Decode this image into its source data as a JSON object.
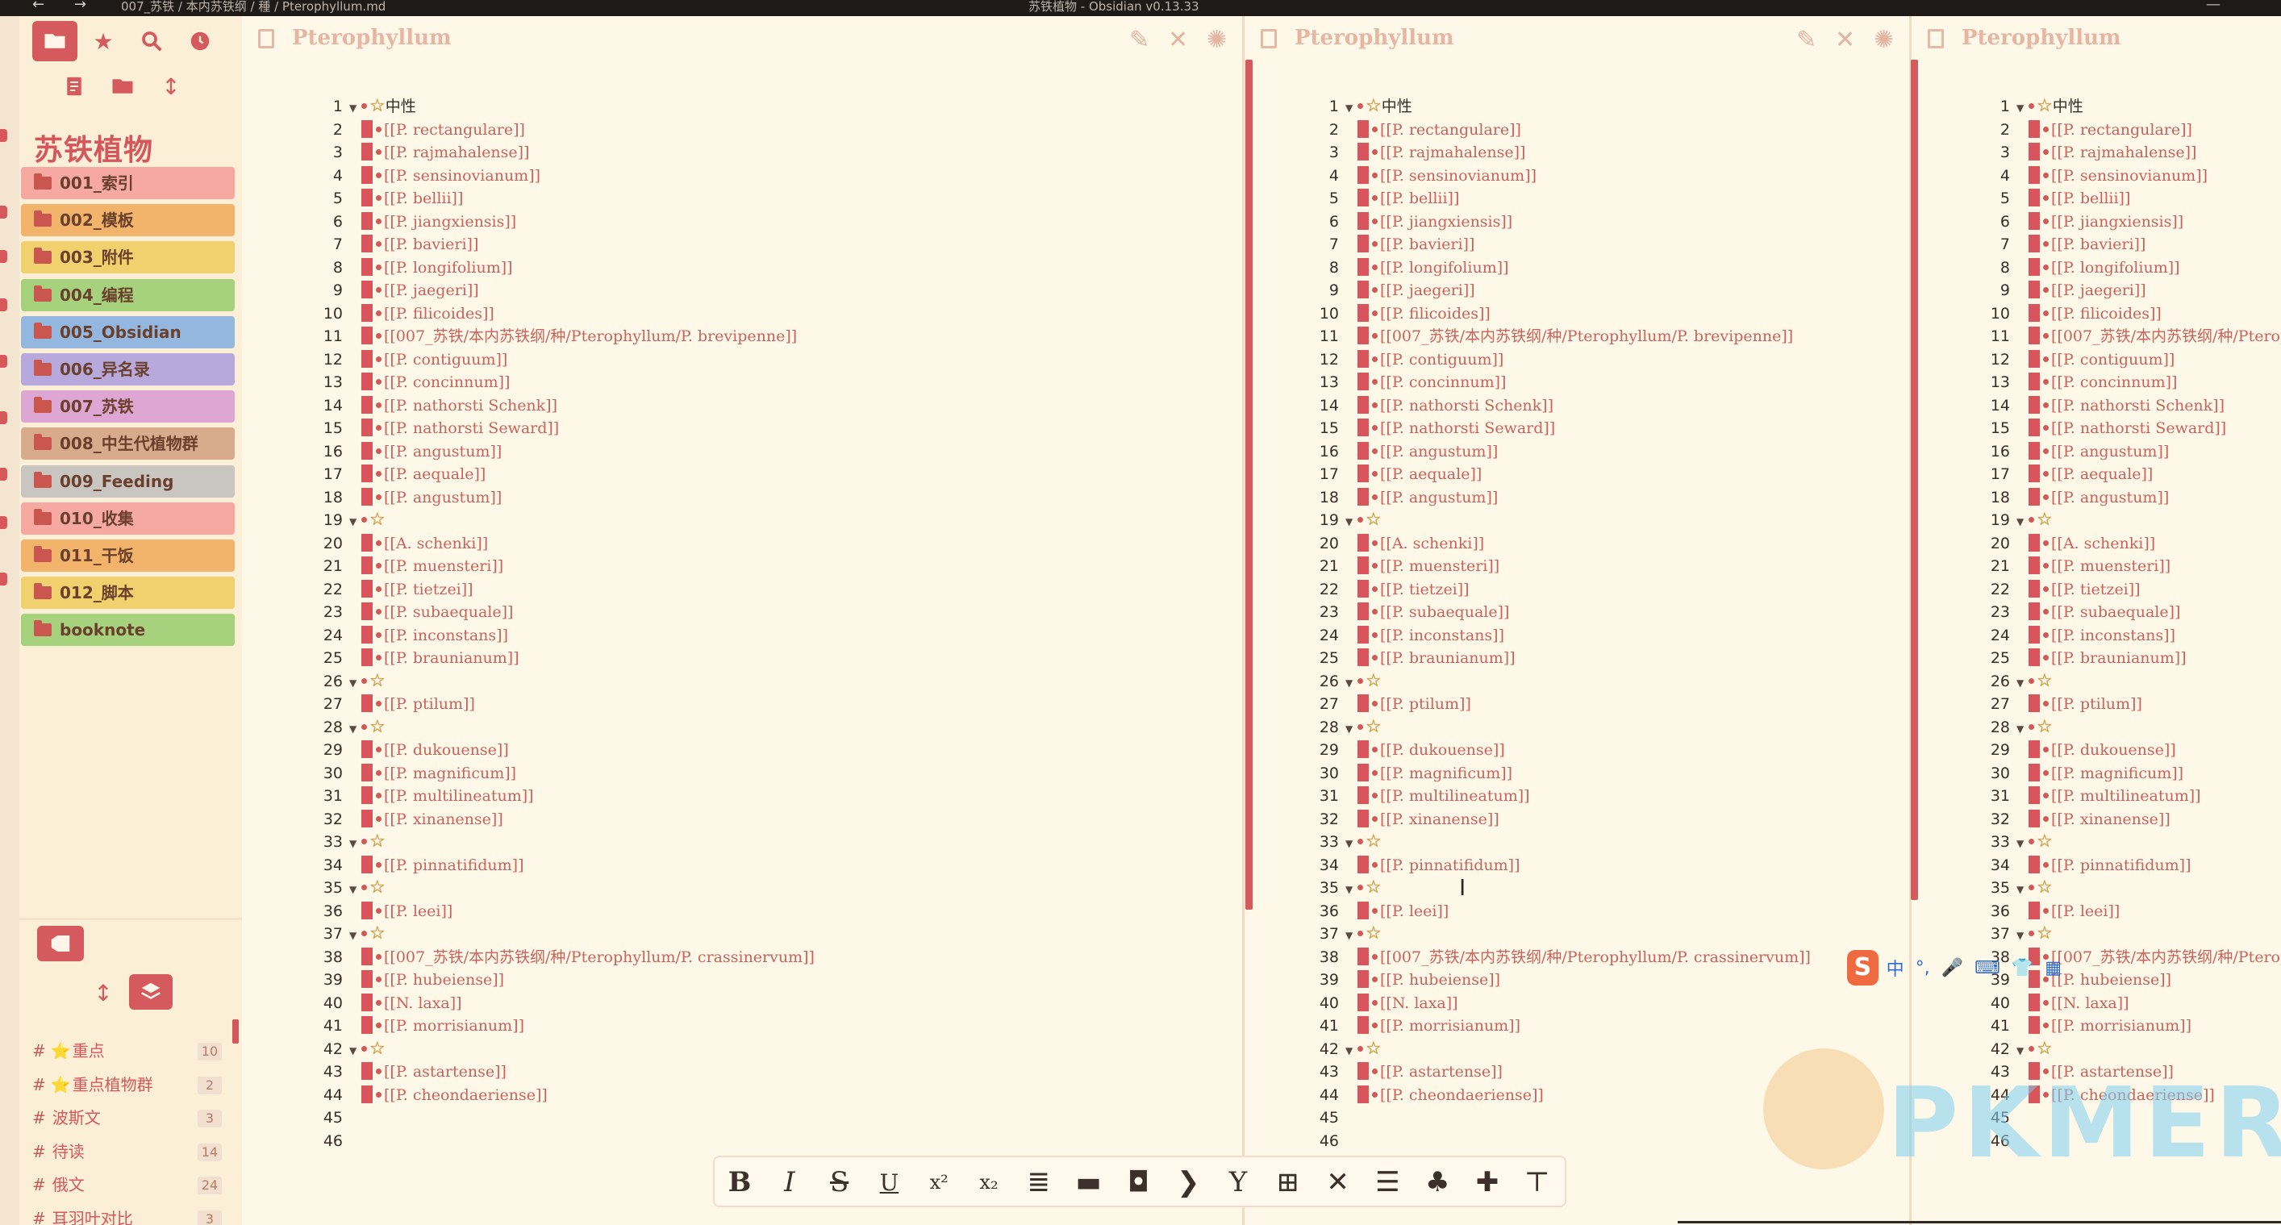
{
  "titlebar": {
    "back": "←",
    "forward": "→",
    "path": "007_苏铁 / 本内苏铁纲 / 種 / Pterophyllum.md",
    "app_title": "苏铁植物 - Obsidian v0.13.33",
    "minimize": "—"
  },
  "sidebar": {
    "vault_name": "苏铁植物",
    "folders": [
      {
        "name": "001_索引",
        "color": "#f6a9a0"
      },
      {
        "name": "002_模板",
        "color": "#f2b46b"
      },
      {
        "name": "003_附件",
        "color": "#f1d06e"
      },
      {
        "name": "004_编程",
        "color": "#a6d17d"
      },
      {
        "name": "005_Obsidian",
        "color": "#93b7df"
      },
      {
        "name": "006_异名录",
        "color": "#b8a9dc"
      },
      {
        "name": "007_苏铁",
        "color": "#dda6d3"
      },
      {
        "name": "008_中生代植物群",
        "color": "#d8ab8d"
      },
      {
        "name": "009_Feeding",
        "color": "#c9c5c0"
      },
      {
        "name": "010_收集",
        "color": "#f6a9a0"
      },
      {
        "name": "011_干饭",
        "color": "#f2b46b"
      },
      {
        "name": "012_脚本",
        "color": "#f1d06e"
      },
      {
        "name": "booknote",
        "color": "#a6d17d"
      }
    ],
    "tags": [
      {
        "hash": "#",
        "star": "⭐",
        "name": "重点",
        "count": "10"
      },
      {
        "hash": "#",
        "star": "⭐",
        "name": "重点植物群",
        "count": "2"
      },
      {
        "hash": "#",
        "star": "",
        "name": "波斯文",
        "count": "3"
      },
      {
        "hash": "#",
        "star": "",
        "name": "待读",
        "count": "14"
      },
      {
        "hash": "#",
        "star": "",
        "name": "俄文",
        "count": "24"
      },
      {
        "hash": "#",
        "star": "",
        "name": "耳羽叶对比",
        "count": "3"
      }
    ]
  },
  "panes": [
    {
      "title": "Pterophyllum"
    },
    {
      "title": "Pterophyllum"
    },
    {
      "title": "Pterophyllum"
    }
  ],
  "document": {
    "lines": [
      {
        "n": "1",
        "fold": "▼",
        "kind": "heading",
        "star": "☆",
        "text": "中性"
      },
      {
        "n": "2",
        "kind": "link",
        "text": "[[P. rectangulare]]"
      },
      {
        "n": "3",
        "kind": "link",
        "text": "[[P. rajmahalense]]"
      },
      {
        "n": "4",
        "kind": "link",
        "text": "[[P. sensinovianum]]"
      },
      {
        "n": "5",
        "kind": "link",
        "text": "[[P. bellii]]"
      },
      {
        "n": "6",
        "kind": "link",
        "text": "[[P. jiangxiensis]]"
      },
      {
        "n": "7",
        "kind": "link",
        "text": "[[P. bavieri]]"
      },
      {
        "n": "8",
        "kind": "link",
        "text": "[[P. longifolium]]"
      },
      {
        "n": "9",
        "kind": "link",
        "text": "[[P. jaegeri]]"
      },
      {
        "n": "10",
        "kind": "link",
        "text": "[[P. filicoides]]"
      },
      {
        "n": "11",
        "kind": "link",
        "text": "[[007_苏铁/本内苏铁纲/种/Pterophyllum/P. brevipenne]]"
      },
      {
        "n": "12",
        "kind": "link",
        "text": "[[P. contiguum]]"
      },
      {
        "n": "13",
        "kind": "link",
        "text": "[[P. concinnum]]"
      },
      {
        "n": "14",
        "kind": "link",
        "text": "[[P. nathorsti Schenk]]"
      },
      {
        "n": "15",
        "kind": "link",
        "text": "[[P. nathorsti Seward]]"
      },
      {
        "n": "16",
        "kind": "link",
        "text": "[[P. angustum]]"
      },
      {
        "n": "17",
        "kind": "link",
        "text": "[[P. aequale]]"
      },
      {
        "n": "18",
        "kind": "link",
        "text": "[[P. angustum]]"
      },
      {
        "n": "19",
        "fold": "▼",
        "kind": "heading",
        "star": "☆",
        "text": ""
      },
      {
        "n": "20",
        "kind": "link",
        "text": "[[A. schenki]]"
      },
      {
        "n": "21",
        "kind": "link",
        "text": "[[P. muensteri]]"
      },
      {
        "n": "22",
        "kind": "link",
        "text": "[[P. tietzei]]"
      },
      {
        "n": "23",
        "kind": "link",
        "text": "[[P. subaequale]]"
      },
      {
        "n": "24",
        "kind": "link",
        "text": "[[P. inconstans]]"
      },
      {
        "n": "25",
        "kind": "link",
        "text": "[[P. braunianum]]"
      },
      {
        "n": "26",
        "fold": "▼",
        "kind": "heading",
        "star": "☆",
        "text": ""
      },
      {
        "n": "27",
        "kind": "link",
        "text": "[[P. ptilum]]"
      },
      {
        "n": "28",
        "fold": "▼",
        "kind": "heading",
        "star": "☆",
        "text": ""
      },
      {
        "n": "29",
        "kind": "link",
        "text": "[[P. dukouense]]"
      },
      {
        "n": "30",
        "kind": "link",
        "text": "[[P. magnificum]]"
      },
      {
        "n": "31",
        "kind": "link",
        "text": "[[P. multilineatum]]"
      },
      {
        "n": "32",
        "kind": "link",
        "text": "[[P. xinanense]]"
      },
      {
        "n": "33",
        "fold": "▼",
        "kind": "heading",
        "star": "☆",
        "text": ""
      },
      {
        "n": "34",
        "kind": "link",
        "text": "[[P. pinnatifidum]]"
      },
      {
        "n": "35",
        "fold": "▼",
        "kind": "heading",
        "star": "☆",
        "text": ""
      },
      {
        "n": "36",
        "kind": "link",
        "text": "[[P. leei]]"
      },
      {
        "n": "37",
        "fold": "▼",
        "kind": "heading",
        "star": "☆",
        "text": ""
      },
      {
        "n": "38",
        "kind": "link",
        "text": "[[007_苏铁/本内苏铁纲/种/Pterophyllum/P. crassinervum]]"
      },
      {
        "n": "39",
        "kind": "link",
        "text": "[[P. hubeiense]]"
      },
      {
        "n": "40",
        "kind": "link",
        "text": "[[N. laxa]]"
      },
      {
        "n": "41",
        "kind": "link",
        "text": "[[P. morrisianum]]"
      },
      {
        "n": "42",
        "fold": "▼",
        "kind": "heading",
        "star": "☆",
        "text": ""
      },
      {
        "n": "43",
        "kind": "link",
        "text": "[[P. astartense]]"
      },
      {
        "n": "44",
        "kind": "link",
        "text": "[[P. cheondaeriense]]"
      },
      {
        "n": "45",
        "kind": "empty",
        "text": ""
      },
      {
        "n": "46",
        "kind": "empty",
        "text": ""
      }
    ]
  },
  "toolbar": {
    "buttons": [
      {
        "name": "bold",
        "glyph": "B"
      },
      {
        "name": "italic",
        "glyph": "I"
      },
      {
        "name": "strikethrough",
        "glyph": "S"
      },
      {
        "name": "underline",
        "glyph": "U"
      },
      {
        "name": "superscript",
        "glyph": "x²"
      },
      {
        "name": "subscript",
        "glyph": "x₂"
      },
      {
        "name": "align",
        "glyph": "≣"
      },
      {
        "name": "divider",
        "glyph": "▬"
      },
      {
        "name": "box",
        "glyph": "◘"
      },
      {
        "name": "chevron",
        "glyph": "❯"
      },
      {
        "name": "fork",
        "glyph": "Y"
      },
      {
        "name": "plus-box",
        "glyph": "⊞"
      },
      {
        "name": "close-x",
        "glyph": "✕"
      },
      {
        "name": "indent",
        "glyph": "☰"
      },
      {
        "name": "format-painter",
        "glyph": "♣"
      },
      {
        "name": "pin",
        "glyph": "✚"
      },
      {
        "name": "clear-format",
        "glyph": "⊤"
      }
    ]
  },
  "ime": {
    "logo": "S",
    "items": [
      "中",
      "°,",
      "🎤",
      "⌨",
      "👕",
      "▦"
    ]
  },
  "watermark": {
    "text": "PKMER"
  }
}
